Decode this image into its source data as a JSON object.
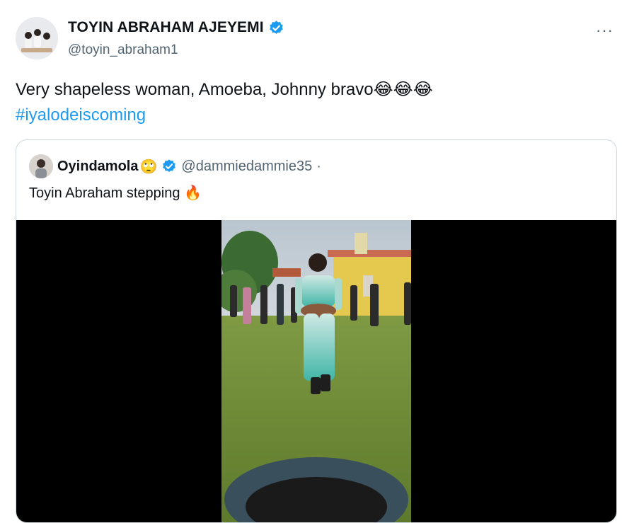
{
  "tweet": {
    "display_name": "TOYIN ABRAHAM AJEYEMI",
    "handle": "@toyin_abraham1",
    "more_label": "···",
    "text": "Very shapeless woman, Amoeba, Johnny bravo",
    "emojis": "😂😂😂",
    "hashtag": "#iyalodeiscoming"
  },
  "quoted": {
    "display_name": "Oyindamola",
    "name_emoji": "🙄",
    "handle": "@dammiedammie35",
    "separator": "·",
    "text": "Toyin Abraham stepping",
    "text_emoji": "🔥"
  },
  "colors": {
    "verified": "#1d9bf0",
    "link": "#1d9bf0",
    "secondary_text": "#536471",
    "border": "#cfd9de"
  },
  "icons": {
    "verified": "verified-badge-icon",
    "more": "more-dots-icon"
  }
}
